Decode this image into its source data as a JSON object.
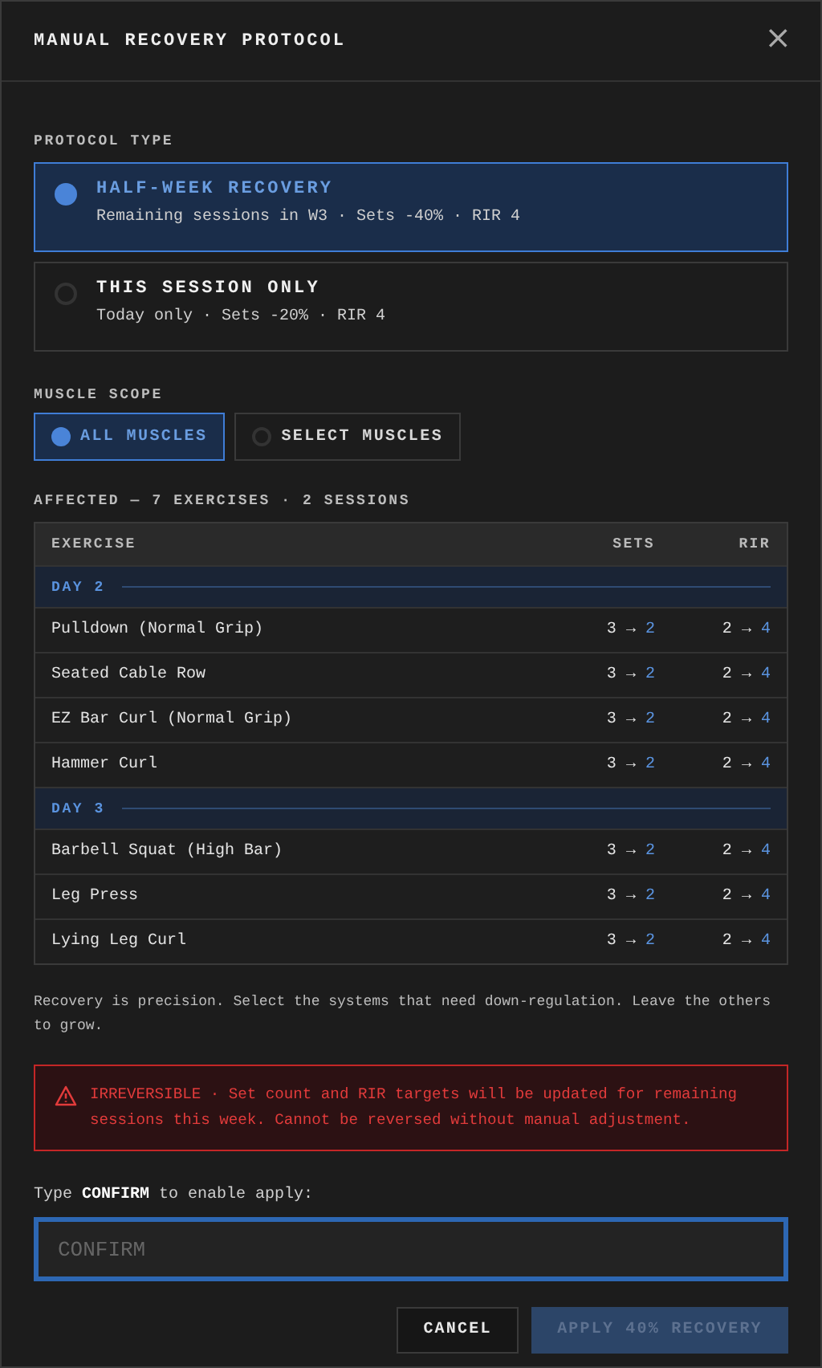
{
  "dialog": {
    "title": "MANUAL RECOVERY PROTOCOL",
    "close": "×"
  },
  "protocol_type": {
    "label": "PROTOCOL TYPE",
    "options": [
      {
        "title": "HALF-WEEK RECOVERY",
        "detail": "Remaining sessions in W3 · Sets -40% · RIR 4",
        "selected": true
      },
      {
        "title": "THIS SESSION ONLY",
        "detail": "Today only · Sets -20% · RIR 4",
        "selected": false
      }
    ]
  },
  "muscle_scope": {
    "label": "MUSCLE SCOPE",
    "options": [
      {
        "label": "ALL MUSCLES",
        "selected": true
      },
      {
        "label": "SELECT MUSCLES",
        "selected": false
      }
    ]
  },
  "affected": {
    "label": "AFFECTED — 7 EXERCISES · 2 SESSIONS"
  },
  "table": {
    "columns": [
      "EXERCISE",
      "SETS",
      "RIR"
    ],
    "rows": [
      {
        "kind": "day",
        "label": "DAY 2"
      },
      {
        "kind": "exercise",
        "name": "Pulldown (Normal Grip)",
        "sets": [
          "3",
          "→",
          "2"
        ],
        "rir": [
          "2",
          "→",
          "4"
        ]
      },
      {
        "kind": "exercise",
        "name": "Seated Cable Row",
        "sets": [
          "3",
          "→",
          "2"
        ],
        "rir": [
          "2",
          "→",
          "4"
        ]
      },
      {
        "kind": "exercise",
        "name": "EZ Bar Curl (Normal Grip)",
        "sets": [
          "3",
          "→",
          "2"
        ],
        "rir": [
          "2",
          "→",
          "4"
        ]
      },
      {
        "kind": "exercise",
        "name": "Hammer Curl",
        "sets": [
          "3",
          "→",
          "2"
        ],
        "rir": [
          "2",
          "→",
          "4"
        ]
      },
      {
        "kind": "day",
        "label": "DAY 3"
      },
      {
        "kind": "exercise",
        "name": "Barbell Squat (High Bar)",
        "sets": [
          "3",
          "→",
          "2"
        ],
        "rir": [
          "2",
          "→",
          "4"
        ]
      },
      {
        "kind": "exercise",
        "name": "Leg Press",
        "sets": [
          "3",
          "→",
          "2"
        ],
        "rir": [
          "2",
          "→",
          "4"
        ]
      },
      {
        "kind": "exercise",
        "name": "Lying Leg Curl",
        "sets": [
          "3",
          "→",
          "2"
        ],
        "rir": [
          "2",
          "→",
          "4"
        ]
      }
    ]
  },
  "note": "Recovery is precision. Select the systems that need down-regulation. Leave the others to grow.",
  "warning": "IRREVERSIBLE · Set count and RIR targets will be updated for remaining sessions this week. Cannot be reversed without manual adjustment.",
  "confirm": {
    "label": "Type **CONFIRM** to enable apply:",
    "placeholder": "CONFIRM",
    "focused": true
  },
  "buttons": [
    {
      "kind": "secondary",
      "label": "CANCEL",
      "disabled": false
    },
    {
      "kind": "primary",
      "label": "APPLY 40% RECOVERY",
      "disabled": true
    }
  ]
}
